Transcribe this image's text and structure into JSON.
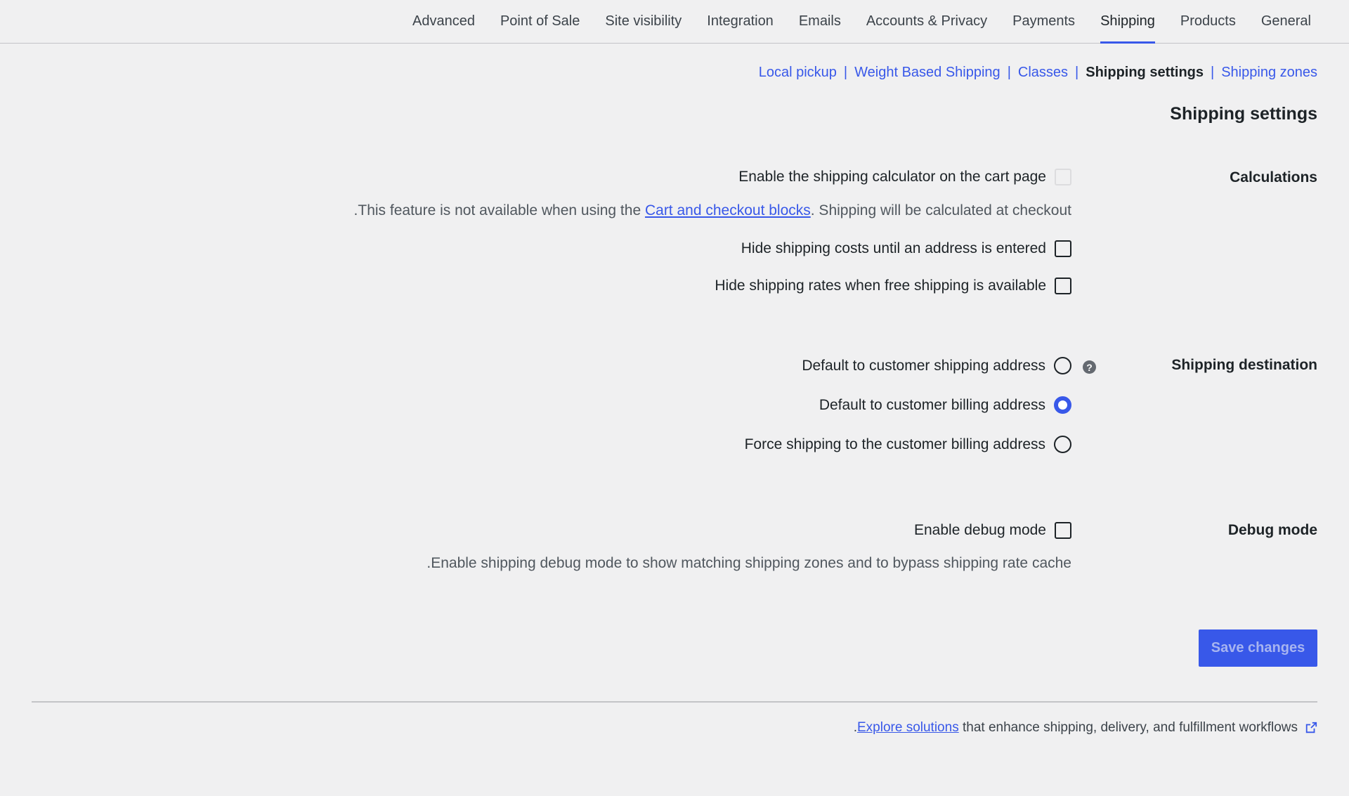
{
  "tabs": [
    "General",
    "Products",
    "Shipping",
    "Payments",
    "Accounts & Privacy",
    "Emails",
    "Integration",
    "Site visibility",
    "Point of Sale",
    "Advanced"
  ],
  "active_tab": "Shipping",
  "subnav": {
    "shipping_zones": "Shipping zones",
    "shipping_settings": "Shipping settings",
    "classes": "Classes",
    "weight_based": "Weight Based Shipping",
    "local_pickup": "Local pickup",
    "separator": "|"
  },
  "page_title": "Shipping settings",
  "calculations": {
    "label": "Calculations",
    "calculator_label": "Enable the shipping calculator on the cart page",
    "calculator_desc_prefix": ".This feature is not available when using the ",
    "calculator_desc_link": "Cart and checkout blocks",
    "calculator_desc_suffix": ". Shipping will be calculated at checkout",
    "hide_costs_label": "Hide shipping costs until an address is entered",
    "hide_rates_label": "Hide shipping rates when free shipping is available"
  },
  "destination": {
    "label": "Shipping destination",
    "help_symbol": "?",
    "options": [
      {
        "label": "Default to customer shipping address",
        "checked": false
      },
      {
        "label": "Default to customer billing address",
        "checked": true
      },
      {
        "label": "Force shipping to the customer billing address",
        "checked": false
      }
    ]
  },
  "debug": {
    "label": "Debug mode",
    "enable_label": "Enable debug mode",
    "desc": ".Enable shipping debug mode to show matching shipping zones and to bypass shipping rate cache"
  },
  "save_label": "Save changes",
  "footer": {
    "prefix": ".",
    "link": "Explore solutions",
    "suffix": " that enhance shipping, delivery, and fulfillment workflows",
    "icon": "external-link-icon"
  },
  "colors": {
    "accent": "#3858e9",
    "background": "#f0f0f1"
  }
}
